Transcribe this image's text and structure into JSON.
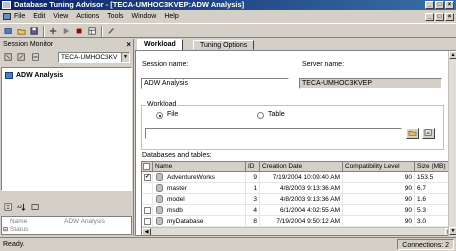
{
  "window": {
    "title": "Database Tuning Advisor - [TECA-UMHOC3KVEP:ADW Analysis]",
    "controls": [
      "_",
      "□",
      "×"
    ],
    "mdi_controls": [
      "_",
      "□",
      "×"
    ]
  },
  "menu": {
    "items": [
      {
        "label": "File"
      },
      {
        "label": "Edit"
      },
      {
        "label": "View"
      },
      {
        "label": "Actions"
      },
      {
        "label": "Tools"
      },
      {
        "label": "Window"
      },
      {
        "label": "Help"
      }
    ]
  },
  "session_monitor": {
    "title": "Session Monitor",
    "close": "×",
    "server_combo": "TECA-UMHOC3KV",
    "session_node": "ADW Analysis",
    "properties": [
      {
        "key": "Name",
        "value": "ADW Analysis"
      },
      {
        "key": "Status",
        "value": ""
      }
    ]
  },
  "tabs": [
    {
      "label": "Workload"
    },
    {
      "label": "Tuning Options"
    }
  ],
  "general": {
    "session_name_label": "Session name:",
    "session_name_value": "ADW Analysis",
    "server_name_label": "Server name:",
    "server_name_value": "TECA-UMHOC3KVEP"
  },
  "workload": {
    "group_title": "Workload",
    "file_label": "File",
    "table_label": "Table",
    "selected": "File",
    "file_value": "",
    "browse_button": "…"
  },
  "databases": {
    "label": "Databases and tables:",
    "columns": [
      "Name",
      "ID",
      "Creation Date",
      "Compatibility Level",
      "Size (MB)"
    ],
    "rows": [
      {
        "name": "AdventureWorks",
        "id": "9",
        "created": "7/19/2004 10:09:40 AM",
        "compat": "90",
        "size": "153.5",
        "checked": true,
        "selected": true
      },
      {
        "name": "master",
        "id": "1",
        "created": "4/8/2003 9:13:36 AM",
        "compat": "90",
        "size": "6.7",
        "checked": false,
        "selected": false,
        "no_checkbox": true
      },
      {
        "name": "model",
        "id": "3",
        "created": "4/8/2003 9:13:36 AM",
        "compat": "90",
        "size": "1.6",
        "checked": false,
        "selected": false,
        "no_checkbox": true
      },
      {
        "name": "msdb",
        "id": "4",
        "created": "6/1/2004 4:02:55 AM",
        "compat": "90",
        "size": "5.3",
        "checked": false,
        "selected": false
      },
      {
        "name": "myDatabase",
        "id": "8",
        "created": "7/19/2004 9:50:12 AM",
        "compat": "90",
        "size": "3.0",
        "checked": false,
        "selected": false
      }
    ]
  },
  "status": {
    "left": "Ready.",
    "right": "Connections: 2"
  }
}
